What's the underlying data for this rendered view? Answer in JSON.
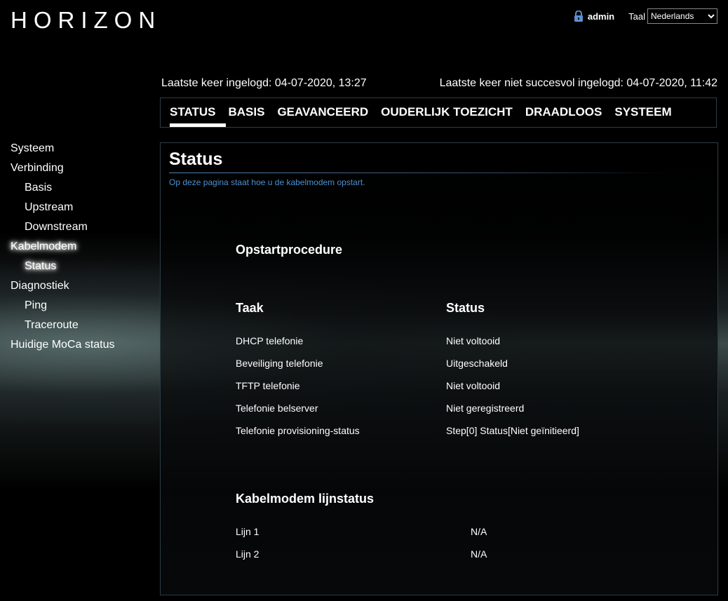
{
  "brand": {
    "logo_text": "HORIZON"
  },
  "topbar": {
    "user": "admin",
    "language_label": "Taal",
    "language_selected": "Nederlands"
  },
  "login_info": {
    "last_login": "Laatste keer ingelogd: 04-07-2020, 13:27",
    "last_failed_login": "Laatste keer niet succesvol ingelogd: 04-07-2020, 11:42"
  },
  "nav": {
    "tabs": [
      {
        "label": "STATUS",
        "active": true
      },
      {
        "label": "BASIS"
      },
      {
        "label": "GEAVANCEERD"
      },
      {
        "label": "OUDERLIJK TOEZICHT"
      },
      {
        "label": "DRAADLOOS"
      },
      {
        "label": "SYSTEEM"
      }
    ]
  },
  "sidebar": {
    "items": [
      {
        "label": "Systeem"
      },
      {
        "label": "Verbinding"
      },
      {
        "label": "Basis"
      },
      {
        "label": "Upstream"
      },
      {
        "label": "Downstream"
      },
      {
        "label": "Kabelmodem",
        "active": true
      },
      {
        "label": "Status",
        "active": true
      },
      {
        "label": "Diagnostiek"
      },
      {
        "label": "Ping"
      },
      {
        "label": "Traceroute"
      },
      {
        "label": "Huidige MoCa status"
      }
    ]
  },
  "main": {
    "title": "Status",
    "description": "Op deze pagina staat hoe u de kabelmodem opstart.",
    "startup": {
      "title": "Opstartprocedure",
      "col_task": "Taak",
      "col_status": "Status",
      "rows": [
        {
          "task": "DHCP telefonie",
          "status": "Niet voltooid"
        },
        {
          "task": "Beveiliging telefonie",
          "status": "Uitgeschakeld"
        },
        {
          "task": "TFTP telefonie",
          "status": "Niet voltooid"
        },
        {
          "task": "Telefonie belserver",
          "status": "Niet geregistreerd"
        },
        {
          "task": "Telefonie provisioning-status",
          "status": "Step[0] Status[Niet geïnitieerd]"
        }
      ]
    },
    "line_status": {
      "title": "Kabelmodem lijnstatus",
      "rows": [
        {
          "line": "Lijn 1",
          "value": "N/A"
        },
        {
          "line": "Lijn 2",
          "value": "N/A"
        }
      ]
    }
  },
  "colors": {
    "accent": "#4d8fcf",
    "border": "#2c3d44"
  },
  "icons": {
    "lock": "lock-icon",
    "logo_mark": "horizon-logo"
  }
}
